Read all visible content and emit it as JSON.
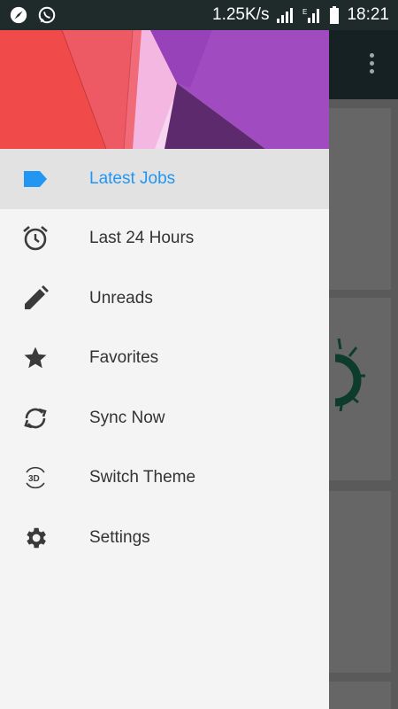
{
  "status_bar": {
    "speed": "1.25K/s",
    "time": "18:21",
    "icons": [
      "compass-icon",
      "whatsapp-icon",
      "signal-icon",
      "signal-edge-icon",
      "battery-icon"
    ]
  },
  "drawer": {
    "active_color": "#2196f3",
    "items": [
      {
        "label": "Latest Jobs",
        "icon": "label-tag-icon",
        "active": true
      },
      {
        "label": "Last 24 Hours",
        "icon": "alarm-clock-icon",
        "active": false
      },
      {
        "label": "Unreads",
        "icon": "pencil-icon",
        "active": false
      },
      {
        "label": "Favorites",
        "icon": "star-icon",
        "active": false
      },
      {
        "label": "Sync Now",
        "icon": "sync-icon",
        "active": false
      },
      {
        "label": "Switch Theme",
        "icon": "3d-rotation-icon",
        "active": false
      },
      {
        "label": "Settings",
        "icon": "gear-icon",
        "active": false
      }
    ]
  }
}
